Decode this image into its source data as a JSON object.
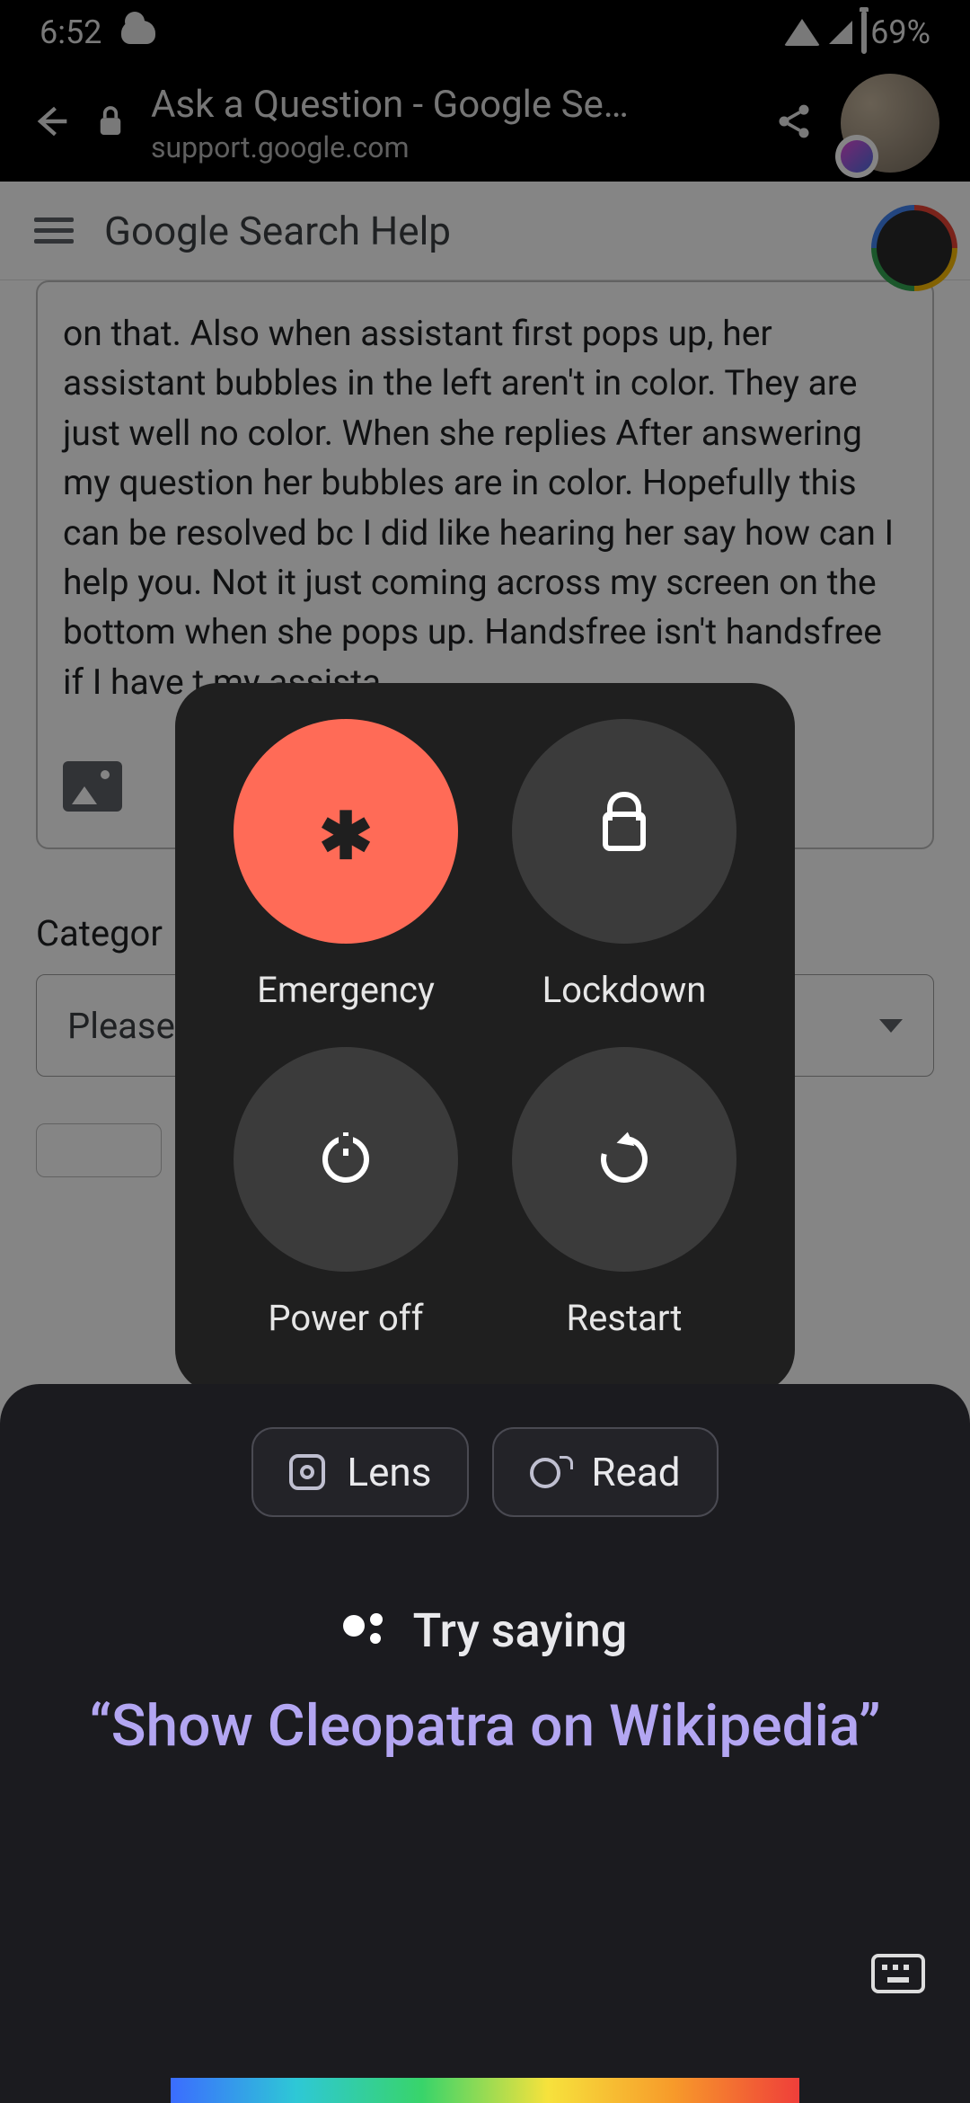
{
  "status": {
    "time": "6:52",
    "battery": "69%"
  },
  "chrome": {
    "title": "Ask a Question - Google Se…",
    "url": "support.google.com"
  },
  "help_header": {
    "title": "Google Search Help"
  },
  "post": {
    "text": "on that.  Also when assistant first pops up, her assistant bubbles in the left aren't in color. They are just well no color.  When she replies After answering my question her bubbles are in color.  Hopefully this can be resolved bc I did like hearing her say how can I help you.  Not it just coming across my screen on the bottom when she pops up.  Handsfree isn't handsfree if I have t                                                               my assista"
  },
  "form": {
    "category_label": "Categor",
    "dropdown_value": "Please"
  },
  "power_menu": {
    "emergency": "Emergency",
    "lockdown": "Lockdown",
    "power_off": "Power off",
    "restart": "Restart"
  },
  "assistant": {
    "lens": "Lens",
    "read": "Read",
    "try_saying": "Try saying",
    "suggestion": "“Show Cleopatra on Wikipedia”"
  }
}
